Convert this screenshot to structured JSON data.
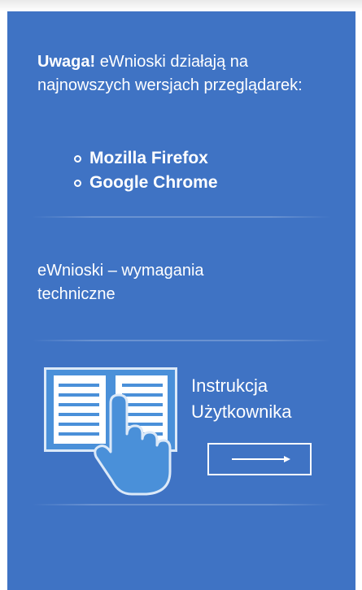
{
  "notice": {
    "prefix": "Uwaga!",
    "text": "eWnioski działają na najnowszych wersjach przeglądarek:"
  },
  "browsers": [
    "Mozilla Firefox",
    "Google Chrome"
  ],
  "requirements_link": "eWnioski – wymagania techniczne",
  "manual": {
    "line1": "Instrukcja",
    "line2": "Użytkownika",
    "icon": "book-hand-icon",
    "button_icon": "arrow-right-icon"
  },
  "colors": {
    "panel": "#3f73c4",
    "icon_fill": "#4a90d9"
  }
}
